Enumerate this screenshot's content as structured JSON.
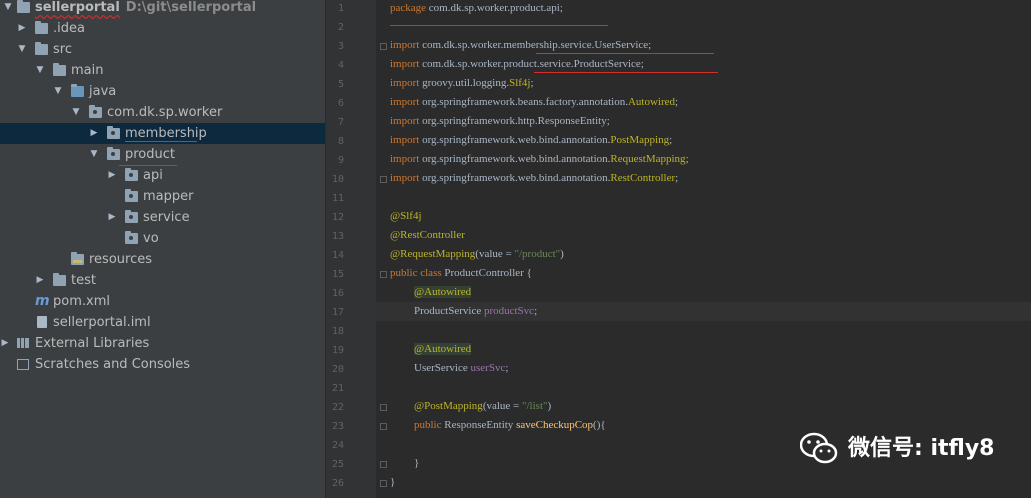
{
  "project_tree": {
    "items": [
      {
        "label": "sellerportal",
        "path": "D:\\git\\sellerportal",
        "arrow": "▼",
        "icon": "project-folder-icon"
      },
      {
        "label": ".idea",
        "arrow": "▶",
        "icon": "folder-icon"
      },
      {
        "label": "src",
        "arrow": "▼",
        "icon": "folder-icon"
      },
      {
        "label": "main",
        "arrow": "▼",
        "icon": "folder-icon"
      },
      {
        "label": "java",
        "arrow": "▼",
        "icon": "source-folder-icon"
      },
      {
        "label": "com.dk.sp.worker",
        "arrow": "▼",
        "icon": "package-icon"
      },
      {
        "label": "membership",
        "arrow": "▶",
        "icon": "package-icon"
      },
      {
        "label": "product",
        "arrow": "▼",
        "icon": "package-icon"
      },
      {
        "label": "api",
        "arrow": "▶",
        "icon": "package-icon"
      },
      {
        "label": "mapper",
        "arrow": "",
        "icon": "package-icon"
      },
      {
        "label": "service",
        "arrow": "▶",
        "icon": "package-icon"
      },
      {
        "label": "vo",
        "arrow": "",
        "icon": "package-icon"
      },
      {
        "label": "resources",
        "arrow": "",
        "icon": "resources-folder-icon"
      },
      {
        "label": "test",
        "arrow": "▶",
        "icon": "folder-icon"
      },
      {
        "label": "pom.xml",
        "arrow": "",
        "icon": "maven-icon"
      },
      {
        "label": "sellerportal.iml",
        "arrow": "",
        "icon": "file-icon"
      },
      {
        "label": "External Libraries",
        "arrow": "▶",
        "icon": "library-icon"
      },
      {
        "label": "Scratches and Consoles",
        "arrow": "",
        "icon": "scratch-icon"
      }
    ]
  },
  "editor": {
    "line_numbers": [
      "1",
      "2",
      "3",
      "4",
      "5",
      "6",
      "7",
      "8",
      "9",
      "10",
      "11",
      "12",
      "13",
      "14",
      "15",
      "16",
      "17",
      "18",
      "19",
      "20",
      "21",
      "22",
      "23",
      "24",
      "25",
      "26"
    ],
    "lines": {
      "l1": {
        "kw": "package",
        "text": " com.dk.sp.worker.product.api;"
      },
      "l3": {
        "kw": "import",
        "text": " com.dk.sp.worker.membership.service.UserService;"
      },
      "l4": {
        "kw": "import",
        "text": " com.dk.sp.worker.product.service.ProductService;"
      },
      "l5": {
        "kw": "import",
        "text": " groovy.util.logging.",
        "ann": "Slf4j",
        "tail": ";"
      },
      "l6": {
        "kw": "import",
        "text": " org.springframework.beans.factory.annotation.",
        "ann": "Autowired",
        "tail": ";"
      },
      "l7": {
        "kw": "import",
        "text": " org.springframework.http.ResponseEntity;"
      },
      "l8": {
        "kw": "import",
        "text": " org.springframework.web.bind.annotation.",
        "ann": "PostMapping",
        "tail": ";"
      },
      "l9": {
        "kw": "import",
        "text": " org.springframework.web.bind.annotation.",
        "ann": "RequestMapping",
        "tail": ";"
      },
      "l10": {
        "kw": "import",
        "text": " org.springframework.web.bind.annotation.",
        "ann": "RestController",
        "tail": ";"
      },
      "l12": {
        "ann": "@Slf4j"
      },
      "l13": {
        "ann": "@RestController"
      },
      "l14": {
        "ann": "@RequestMapping",
        "text": "(value = ",
        "str": "\"/product\"",
        "tail": ")"
      },
      "l15": {
        "kw": "public class",
        "text": " ProductController {"
      },
      "l16": {
        "ann": "@Autowired"
      },
      "l17": {
        "text": "ProductService ",
        "field": "productSvc",
        "tail": ";"
      },
      "l19": {
        "ann": "@Autowired"
      },
      "l20": {
        "text": "UserService ",
        "field": "userSvc",
        "tail": ";"
      },
      "l22": {
        "ann": "@PostMapping",
        "text": "(value = ",
        "str": "\"/list\"",
        "tail": ")"
      },
      "l23": {
        "kw": "public",
        "text": " ResponseEntity ",
        "fn": "saveCheckupCop",
        "tail": "(){"
      },
      "l25": {
        "text": "}"
      },
      "l26": {
        "text": "}"
      }
    }
  },
  "watermark": {
    "text": "微信号: itfly8",
    "icon": "wechat-icon"
  }
}
